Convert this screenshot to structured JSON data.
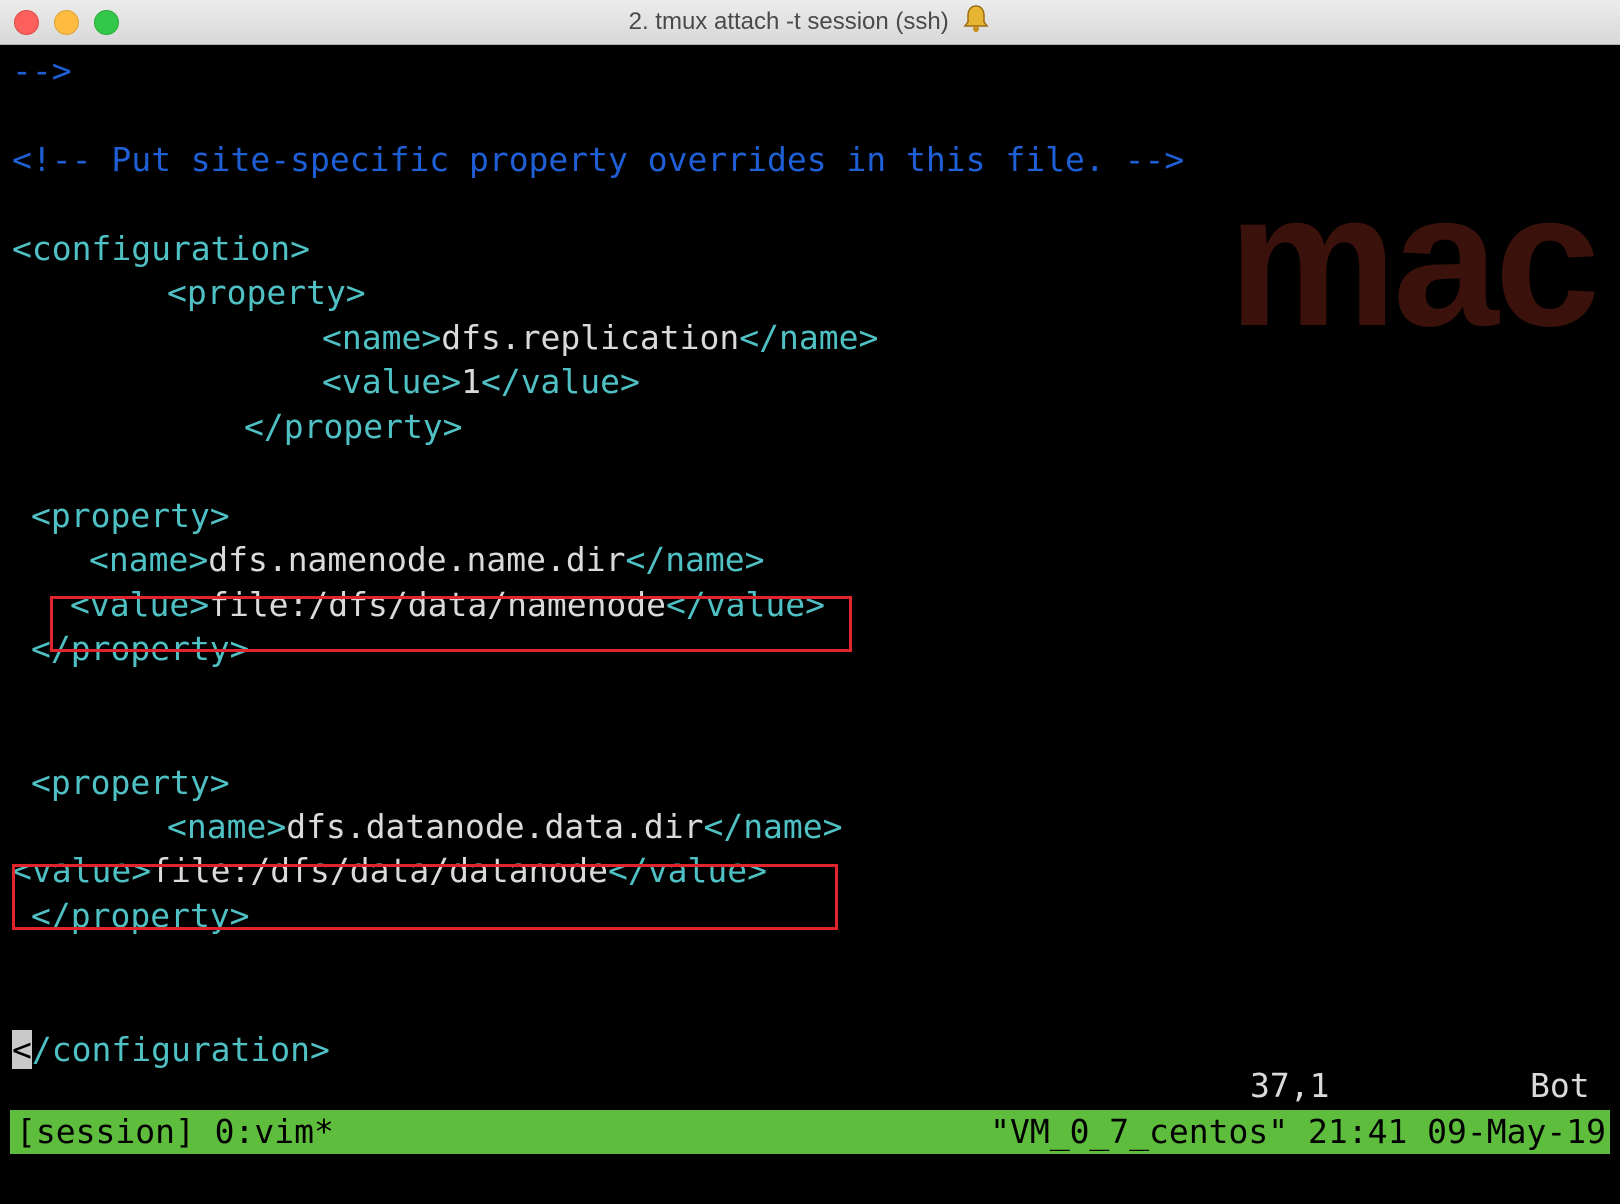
{
  "window": {
    "title": "2. tmux attach -t session (ssh)",
    "bell_icon": "bell-icon"
  },
  "watermark": "mac",
  "editor": {
    "lines": [
      {
        "parts": [
          {
            "t": "-->",
            "c": "cm"
          }
        ]
      },
      {
        "parts": [
          {
            "t": "<!-- Put site-specific property overrides in this file. -->",
            "c": "cm"
          }
        ]
      },
      {
        "parts": [
          {
            "t": "<configuration>",
            "c": "tg"
          }
        ]
      },
      {
        "parts": [
          {
            "t": "<property>",
            "c": "tg"
          }
        ]
      },
      {
        "parts": [
          {
            "t": "<name>",
            "c": "tg"
          },
          {
            "t": "dfs.replication",
            "c": "tx"
          },
          {
            "t": "</name>",
            "c": "tg"
          }
        ]
      },
      {
        "parts": [
          {
            "t": "<value>",
            "c": "tg"
          },
          {
            "t": "1",
            "c": "tx"
          },
          {
            "t": "</value>",
            "c": "tg"
          }
        ]
      },
      {
        "parts": [
          {
            "t": "</property>",
            "c": "tg"
          }
        ]
      },
      {
        "parts": [
          {
            "t": "<property>",
            "c": "tg"
          }
        ]
      },
      {
        "parts": [
          {
            "t": "<name>",
            "c": "tg"
          },
          {
            "t": "dfs.namenode.name.dir",
            "c": "tx"
          },
          {
            "t": "</name>",
            "c": "tg"
          }
        ]
      },
      {
        "parts": [
          {
            "t": "<value>",
            "c": "tg"
          },
          {
            "t": "file:/dfs/data/namenode",
            "c": "tx"
          },
          {
            "t": "</value>",
            "c": "tg"
          }
        ]
      },
      {
        "parts": [
          {
            "t": "</property>",
            "c": "tg"
          }
        ]
      },
      {
        "parts": [
          {
            "t": "<property>",
            "c": "tg"
          }
        ]
      },
      {
        "parts": [
          {
            "t": "<name>",
            "c": "tg"
          },
          {
            "t": "dfs.datanode.data.dir",
            "c": "tx"
          },
          {
            "t": "</name>",
            "c": "tg"
          }
        ]
      },
      {
        "parts": [
          {
            "t": "<value>",
            "c": "tg"
          },
          {
            "t": "file:/dfs/data/datanode",
            "c": "tx"
          },
          {
            "t": "</value>",
            "c": "tg"
          }
        ]
      },
      {
        "parts": [
          {
            "t": "</property>",
            "c": "tg"
          }
        ]
      },
      {
        "parts": [
          {
            "t": "<",
            "c": "cursor"
          },
          {
            "t": "/configuration>",
            "c": "tg"
          }
        ]
      }
    ],
    "cursor_position": "37,1",
    "scroll_position": "Bot"
  },
  "tmux": {
    "left": "[session] 0:vim*",
    "right": "\"VM_0_7_centos\" 21:41 09-May-19"
  },
  "colors": {
    "comment": "#1f5fd6",
    "tag": "#4fc1c4",
    "text": "#dadada",
    "statusbar": "#5fbd3e",
    "highlight_box": "#e1232b",
    "watermark": "#3b120b"
  }
}
